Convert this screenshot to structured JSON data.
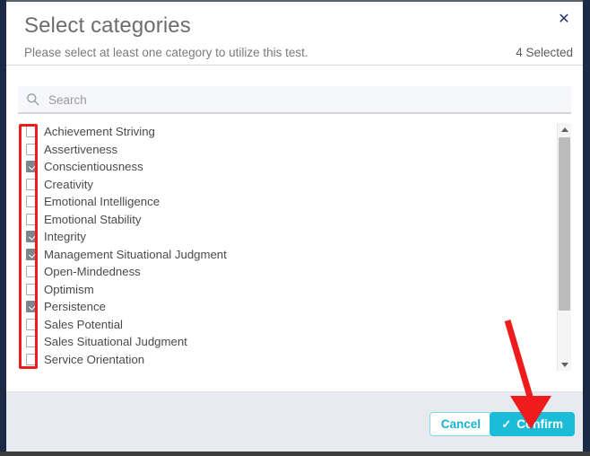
{
  "dialog": {
    "title": "Select categories",
    "subtitle": "Please select at least one category to utilize this test.",
    "selected_count_label": "4 Selected",
    "close_icon": "close-icon",
    "close_glyph": "✕"
  },
  "search": {
    "placeholder": "Search",
    "value": "",
    "icon": "search-icon"
  },
  "list": {
    "items": [
      {
        "label": "Achievement Striving",
        "checked": false
      },
      {
        "label": "Assertiveness",
        "checked": false
      },
      {
        "label": "Conscientiousness",
        "checked": true
      },
      {
        "label": "Creativity",
        "checked": false
      },
      {
        "label": "Emotional Intelligence",
        "checked": false
      },
      {
        "label": "Emotional Stability",
        "checked": false
      },
      {
        "label": "Integrity",
        "checked": true
      },
      {
        "label": "Management Situational Judgment",
        "checked": true
      },
      {
        "label": "Open-Mindedness",
        "checked": false
      },
      {
        "label": "Optimism",
        "checked": false
      },
      {
        "label": "Persistence",
        "checked": true
      },
      {
        "label": "Sales Potential",
        "checked": false
      },
      {
        "label": "Sales Situational Judgment",
        "checked": false
      },
      {
        "label": "Service Orientation",
        "checked": false
      }
    ]
  },
  "scrollbar": {
    "up_arrow_icon": "scroll-up-arrow-icon",
    "down_arrow_icon": "scroll-down-arrow-icon",
    "thumb": "scrollbar-thumb"
  },
  "footer": {
    "cancel_label": "Cancel",
    "confirm_label": "Confirm",
    "confirm_check_glyph": "✓"
  },
  "annotations": {
    "highlight_color": "#ee1c1c",
    "arrow_color": "#ee1c1c",
    "checkbox_column_highlight": "checkbox-column-highlight",
    "pointer_arrow": "confirm-button-pointer-arrow"
  },
  "colors": {
    "accent": "#1bbcd8",
    "cancel_border": "#7fd9e8",
    "checkbox_checked": "#7e858c",
    "footer_bg": "#e8eaef",
    "close_icon": "#23356b"
  }
}
